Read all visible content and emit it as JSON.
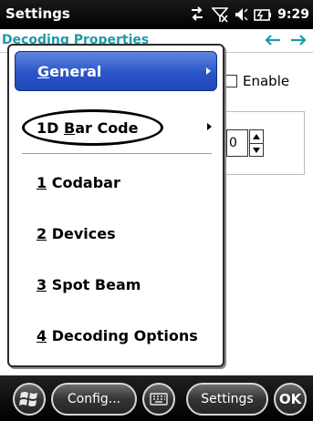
{
  "titlebar": {
    "title": "Settings",
    "time": "9:29",
    "icons": [
      "connectivity-icon",
      "signal-off-icon",
      "volume-icon",
      "battery-charging-icon"
    ]
  },
  "page": {
    "heading": "Decoding Properties",
    "nav_icons": [
      "back-arrow-icon",
      "forward-arrow-icon"
    ],
    "enable_label": "Enable",
    "number_value": "0"
  },
  "menu": {
    "items": [
      {
        "label_access": "G",
        "label_rest": "eneral",
        "has_submenu": true,
        "selected": true
      },
      {
        "label_pre": "1D ",
        "label_access": "B",
        "label_rest": "ar Code",
        "has_submenu": true,
        "selected": false
      },
      {
        "label_access": "1",
        "label_rest": " Codabar",
        "has_submenu": false
      },
      {
        "label_access": "2",
        "label_rest": " Devices",
        "has_submenu": false
      },
      {
        "label_access": "3",
        "label_rest": " Spot Beam",
        "has_submenu": false
      },
      {
        "label_access": "4",
        "label_rest": " Decoding Options",
        "has_submenu": false
      }
    ]
  },
  "taskbar": {
    "config_label": "Config...",
    "settings_label": "Settings",
    "ok_label": "OK"
  },
  "colors": {
    "accent_heading": "#1f9aa8",
    "menu_selected": "#2a55c8"
  }
}
